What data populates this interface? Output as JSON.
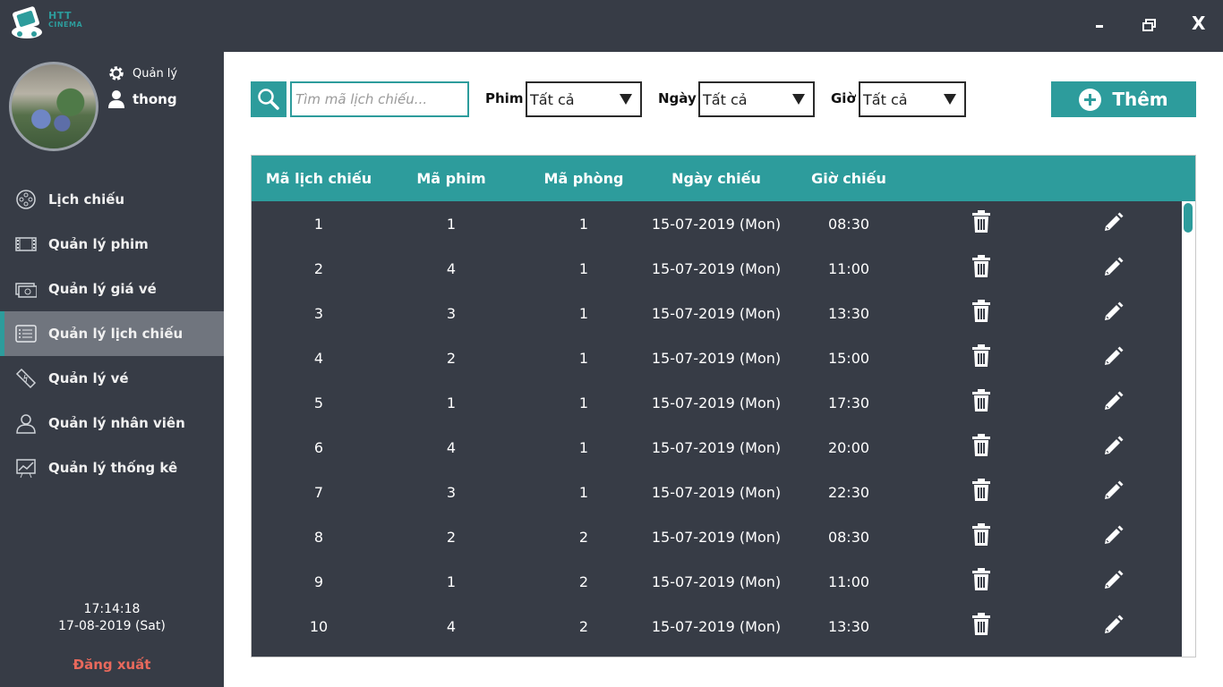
{
  "app": {
    "logo_line1": "HTT",
    "logo_line2": "CINEMA"
  },
  "window": {
    "close_label": "X"
  },
  "user": {
    "role": "Quản lý",
    "name": "thong"
  },
  "menu": [
    {
      "label": "Lịch chiếu",
      "icon": "film-reel-icon",
      "active": false
    },
    {
      "label": "Quản lý phim",
      "icon": "film-strip-icon",
      "active": false
    },
    {
      "label": "Quản lý giá vé",
      "icon": "money-icon",
      "active": false
    },
    {
      "label": "Quản lý lịch chiếu",
      "icon": "schedule-list-icon",
      "active": true
    },
    {
      "label": "Quản lý vé",
      "icon": "ticket-icon",
      "active": false
    },
    {
      "label": "Quản lý nhân viên",
      "icon": "employee-icon",
      "active": false
    },
    {
      "label": "Quản lý thống kê",
      "icon": "statistics-icon",
      "active": false
    }
  ],
  "clock": {
    "time": "17:14:18",
    "date": "17-08-2019 (Sat)"
  },
  "logout_label": "Đăng xuất",
  "search": {
    "placeholder": "Tìm mã lịch chiếu..."
  },
  "filters": {
    "phim": {
      "label": "Phim",
      "value": "Tất cả"
    },
    "ngay": {
      "label": "Ngày",
      "value": "Tất cả"
    },
    "gio": {
      "label": "Giờ",
      "value": "Tất cả"
    }
  },
  "add_button_label": "Thêm",
  "table": {
    "columns": [
      "Mã lịch chiếu",
      "Mã phim",
      "Mã phòng",
      "Ngày chiếu",
      "Giờ chiếu"
    ],
    "rows": [
      [
        "1",
        "1",
        "1",
        "15-07-2019 (Mon)",
        "08:30"
      ],
      [
        "2",
        "4",
        "1",
        "15-07-2019 (Mon)",
        "11:00"
      ],
      [
        "3",
        "3",
        "1",
        "15-07-2019 (Mon)",
        "13:30"
      ],
      [
        "4",
        "2",
        "1",
        "15-07-2019 (Mon)",
        "15:00"
      ],
      [
        "5",
        "1",
        "1",
        "15-07-2019 (Mon)",
        "17:30"
      ],
      [
        "6",
        "4",
        "1",
        "15-07-2019 (Mon)",
        "20:00"
      ],
      [
        "7",
        "3",
        "1",
        "15-07-2019 (Mon)",
        "22:30"
      ],
      [
        "8",
        "2",
        "2",
        "15-07-2019 (Mon)",
        "08:30"
      ],
      [
        "9",
        "1",
        "2",
        "15-07-2019 (Mon)",
        "11:00"
      ],
      [
        "10",
        "4",
        "2",
        "15-07-2019 (Mon)",
        "13:30"
      ]
    ]
  },
  "colors": {
    "accent": "#2d9c9c",
    "dark": "#373c46",
    "active_menu": "#70757e",
    "logout": "#e9695c"
  }
}
